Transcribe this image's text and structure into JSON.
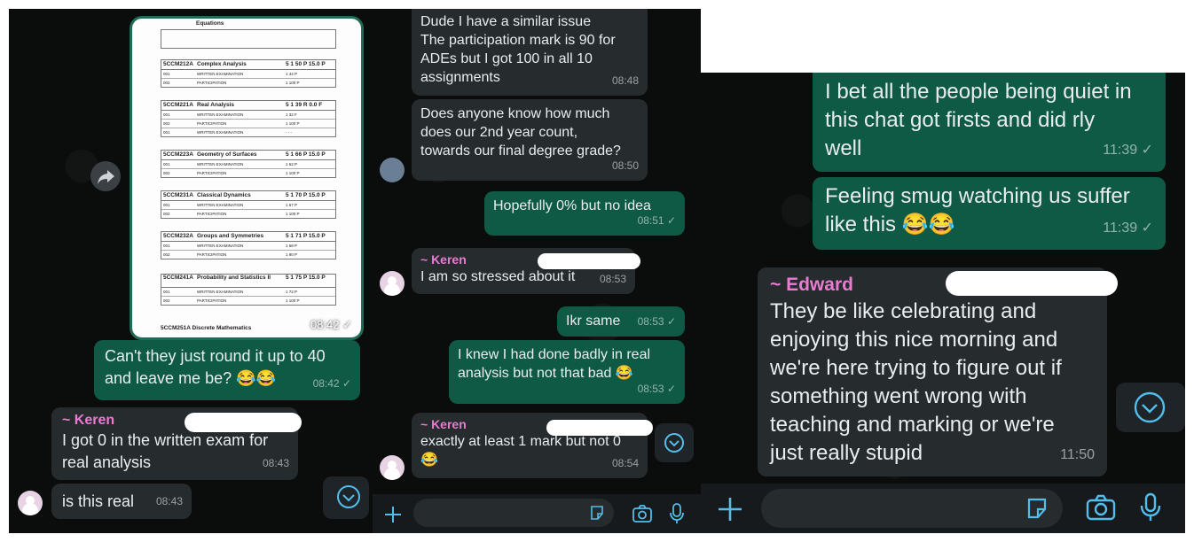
{
  "panel1": {
    "document": {
      "first_title": "Equations",
      "modules": [
        {
          "code": "5CCM212A",
          "title": "Complex Analysis",
          "result": "5  1  50  P  15.0  P",
          "rows": [
            [
              "001",
              "WRITTEN EXAMINATION",
              "1  44  P"
            ],
            [
              "002",
              "PARTICIPATION",
              "1  100  P"
            ]
          ]
        },
        {
          "code": "5CCM221A",
          "title": "Real Analysis",
          "result": "5  1  39  R  0.0  F",
          "rows": [
            [
              "001",
              "WRITTEN EXAMINATION",
              "1  32  F"
            ],
            [
              "002",
              "PARTICIPATION",
              "1  100  P"
            ],
            [
              "001",
              "WRITTEN EXAMINATION",
              "-  -  -"
            ]
          ]
        },
        {
          "code": "5CCM223A",
          "title": "Geometry of Surfaces",
          "result": "5  1  66  P  15.0  P",
          "rows": [
            [
              "001",
              "WRITTEN EXAMINATION",
              "1  62  P"
            ],
            [
              "002",
              "PARTICIPATION",
              "1  100  P"
            ]
          ]
        },
        {
          "code": "5CCM231A",
          "title": "Classical Dynamics",
          "result": "5  1  70  P  15.0  P",
          "rows": [
            [
              "001",
              "WRITTEN EXAMINATION",
              "1  67  P"
            ],
            [
              "002",
              "PARTICIPATION",
              "1  100  P"
            ]
          ]
        },
        {
          "code": "5CCM232A",
          "title": "Groups and Symmetries",
          "result": "5  1  71  P  15.0  P",
          "rows": [
            [
              "001",
              "WRITTEN EXAMINATION",
              "1  68  P"
            ],
            [
              "002",
              "PARTICIPATION",
              "1  90  P"
            ]
          ]
        },
        {
          "code": "5CCM241A",
          "title": "Probability and Statistics II",
          "result": "5  1  75  P  15.0  P",
          "rows": [
            [
              "001",
              "WRITTEN EXAMINATION",
              "1  72  P"
            ],
            [
              "002",
              "PARTICIPATION",
              "1  100  P"
            ]
          ]
        }
      ],
      "last_title": "5CCM251A Discrete Mathematics",
      "time": "08:42 ✓"
    },
    "messages": [
      {
        "text": "Can't they just round it up to 40\nand leave me be? 😂😂",
        "time": "08:42 ✓"
      },
      {
        "sender": "~ Keren",
        "text": "I got 0 in the written exam for\nreal analysis",
        "time": "08:43"
      },
      {
        "text": "is this real",
        "time": "08:43"
      }
    ]
  },
  "panel2": {
    "messages": [
      {
        "text": "Dude I have a similar issue\nThe participation mark is 90 for\nADEs but I got 100 in all 10\nassignments",
        "time": "08:48"
      },
      {
        "text": "Does anyone know how much\ndoes our 2nd year count,\ntowards our final degree grade?",
        "time": "08:50"
      },
      {
        "text": "Hopefully 0% but no idea",
        "time": "08:51 ✓"
      },
      {
        "sender": "~ Keren",
        "text": "I am so stressed about it",
        "time": "08:53"
      },
      {
        "text": "Ikr same",
        "time": "08:53 ✓"
      },
      {
        "text": "I knew I had done badly in real\nanalysis but not that bad 😂",
        "time": "08:53 ✓"
      },
      {
        "sender": "~ Keren",
        "text": "exactly at least 1 mark but not 0\n😂",
        "time": "08:54"
      }
    ]
  },
  "panel3": {
    "messages": [
      {
        "text": "I bet all the people being quiet in\nthis chat got firsts and did rly\nwell",
        "time": "11:39 ✓"
      },
      {
        "text": "Feeling smug watching us suffer\nlike this 😂😂",
        "time": "11:39 ✓"
      },
      {
        "sender": "~ Edward",
        "text": "They be like celebrating and\nenjoying this nice morning and\nwe're here trying to figure out if\nsomething went wrong with\nteaching and marking or we're\njust really stupid",
        "time": "11:50"
      }
    ]
  },
  "colors": {
    "background": "#0b0d0c",
    "incoming": "#262b2e",
    "outgoing": "#0f5a45",
    "sender_pink": "#ea7bd3",
    "accent_blue": "#53bdeb"
  },
  "icons": [
    "forward-icon",
    "scroll-down-icon",
    "plus-icon",
    "sticker-icon",
    "camera-icon",
    "microphone-icon"
  ]
}
